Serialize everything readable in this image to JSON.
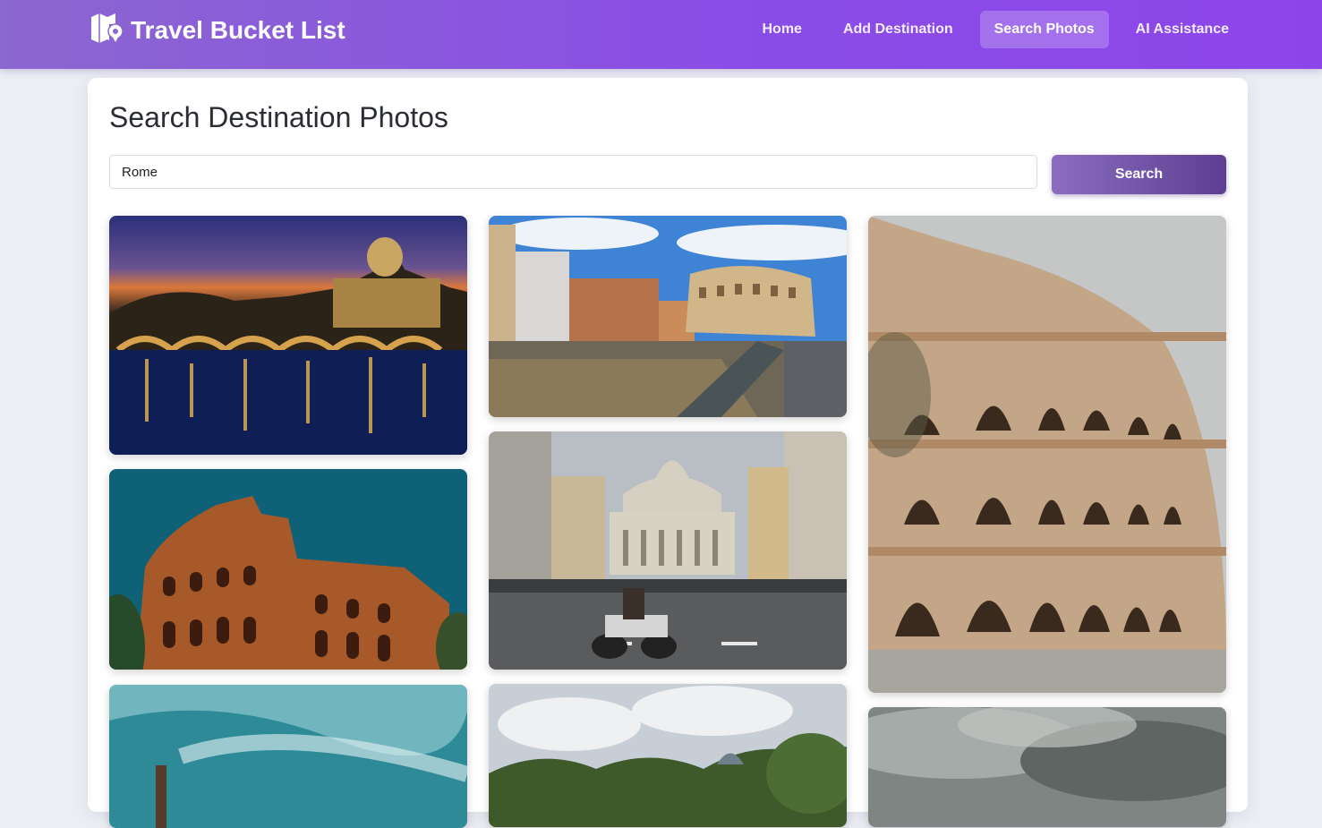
{
  "brand": {
    "name": "Travel Bucket List",
    "icon": "map-pin-icon"
  },
  "nav": {
    "items": [
      {
        "label": "Home",
        "active": false
      },
      {
        "label": "Add Destination",
        "active": false
      },
      {
        "label": "Search Photos",
        "active": true
      },
      {
        "label": "AI Assistance",
        "active": false
      }
    ]
  },
  "page": {
    "title": "Search Destination Photos"
  },
  "search": {
    "value": "Rome",
    "placeholder": "",
    "button_label": "Search"
  },
  "photos": [
    {
      "subject": "St. Peter's Basilica and Ponte Sant'Angelo at night"
    },
    {
      "subject": "Colosseum with street and ruins"
    },
    {
      "subject": "Colosseum facade close-up"
    },
    {
      "subject": "Colosseum against blue sky"
    },
    {
      "subject": "Via della Conciliazione toward St. Peter's"
    },
    {
      "subject": "Cloudy sky over ruins"
    },
    {
      "subject": "Trees and dome under clouds"
    },
    {
      "subject": "Stormy sky"
    }
  ],
  "colors": {
    "nav_gradient_start": "#8b67d0",
    "nav_gradient_end": "#8d45ea",
    "button_gradient_start": "#8a6dbf",
    "button_gradient_end": "#5d3f92",
    "page_background": "#eceef4"
  }
}
